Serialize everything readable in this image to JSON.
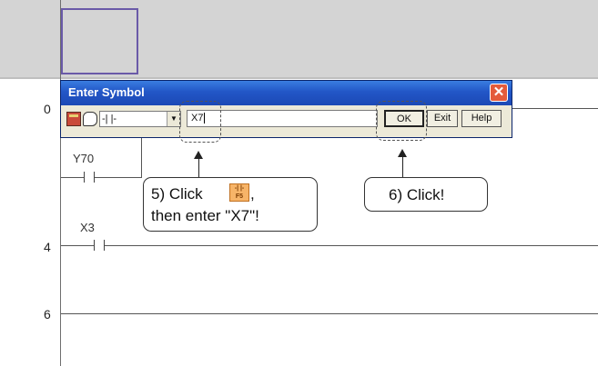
{
  "ladder": {
    "rung_numbers": [
      "0",
      "4",
      "6"
    ],
    "contacts": [
      "Y70",
      "X3"
    ]
  },
  "dialog": {
    "title": "Enter Symbol",
    "close_glyph": "✕",
    "symbol_combo_value": "-| |-",
    "symbol_input_value": "X7",
    "ok_label": "OK",
    "exit_label": "Exit",
    "help_label": "Help"
  },
  "callouts": {
    "step5_line1": "5) Click",
    "step5_line1_suffix": ",",
    "step5_line2": "then enter \"X7\"!",
    "f5_key_top": "-| |-",
    "f5_key_bottom": "F5",
    "step6": "6) Click!"
  },
  "colors": {
    "titlebar": "#2256c7",
    "close_button": "#e45b3b",
    "f5_key": "#f7b468",
    "cursor_frame": "#6a5aa8"
  }
}
